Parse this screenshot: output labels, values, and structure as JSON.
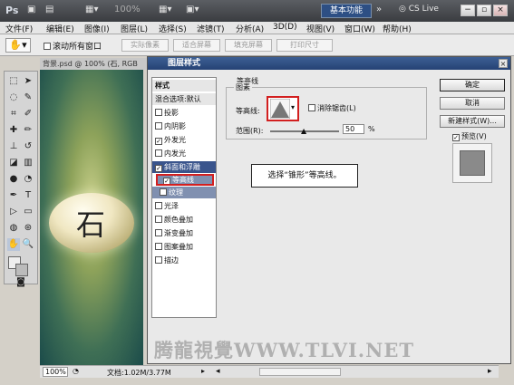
{
  "app": {
    "logo": "Ps",
    "zoom": "100%",
    "workspace": "基本功能",
    "cslive": "CS Live"
  },
  "menu": [
    "文件(F)",
    "编辑(E)",
    "图像(I)",
    "图层(L)",
    "选择(S)",
    "滤镜(T)",
    "分析(A)",
    "3D(D)",
    "视图(V)",
    "窗口(W)",
    "帮助(H)"
  ],
  "options": {
    "scroll_all": "滚动所有窗口",
    "buttons": [
      "实际像素",
      "适合屏幕",
      "填充屏幕",
      "打印尺寸"
    ]
  },
  "document": {
    "tab": "背景.psd @ 100% (石, RGB",
    "stone_char": "石",
    "zoom": "100%",
    "doc_info": "文档:1.02M/3.77M"
  },
  "dialog": {
    "title": "图层样式",
    "styles_header": "样式",
    "blend_options": "混合选项:默认",
    "items": [
      {
        "label": "投影",
        "checked": false
      },
      {
        "label": "内阴影",
        "checked": false
      },
      {
        "label": "外发光",
        "checked": true
      },
      {
        "label": "内发光",
        "checked": false
      },
      {
        "label": "斜面和浮雕",
        "checked": true
      },
      {
        "label": "等高线",
        "checked": true
      },
      {
        "label": "纹理",
        "checked": false
      },
      {
        "label": "光泽",
        "checked": false
      },
      {
        "label": "颜色叠加",
        "checked": false
      },
      {
        "label": "渐变叠加",
        "checked": false
      },
      {
        "label": "图案叠加",
        "checked": false
      },
      {
        "label": "描边",
        "checked": false
      }
    ],
    "section_title": "等高线",
    "group_title": "图素",
    "contour_label": "等高线:",
    "antialias_label": "消除锯齿(L)",
    "range_label": "范围(R):",
    "range_value": "50",
    "range_unit": "%",
    "buttons": {
      "ok": "确定",
      "cancel": "取消",
      "new_style": "新建样式(W)...",
      "preview": "预览(V)"
    },
    "callout": "选择“锥形”等高线。"
  },
  "watermark": "腾龍視覺WWW.TLVI.NET",
  "colors": {
    "titlebar": "#3a3c40",
    "dialog_title": "#254274",
    "selection": "#39548c",
    "highlight": "#d21f1f"
  }
}
